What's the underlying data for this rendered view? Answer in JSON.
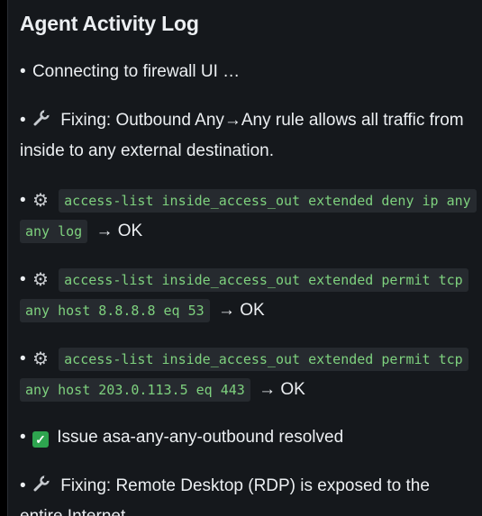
{
  "title": "Agent Activity Log",
  "entries": [
    {
      "kind": "status",
      "text": "Connecting to firewall UI …"
    },
    {
      "kind": "fixing",
      "text": "Fixing: Outbound Any→Any rule allows all traffic from inside to any external destination."
    },
    {
      "kind": "command",
      "code": "access-list inside_access_out extended deny ip any any log",
      "result": "→ OK"
    },
    {
      "kind": "command",
      "code": "access-list inside_access_out extended permit tcp any host 8.8.8.8 eq 53",
      "result": "→ OK"
    },
    {
      "kind": "command",
      "code": "access-list inside_access_out extended permit tcp any host 203.0.113.5 eq 443",
      "result": "→ OK"
    },
    {
      "kind": "resolved",
      "text": "Issue asa-any-any-outbound resolved"
    },
    {
      "kind": "fixing",
      "text": "Fixing: Remote Desktop (RDP) is exposed to the entire Internet."
    }
  ],
  "icons": {
    "fixing": "wrench-icon",
    "command": "gear-icon",
    "resolved": "check-icon"
  },
  "colors": {
    "background": "#15181c",
    "text": "#eceff2",
    "code_text": "#7ed17e",
    "code_background": "#262a2f",
    "check": "#2ea44f"
  }
}
